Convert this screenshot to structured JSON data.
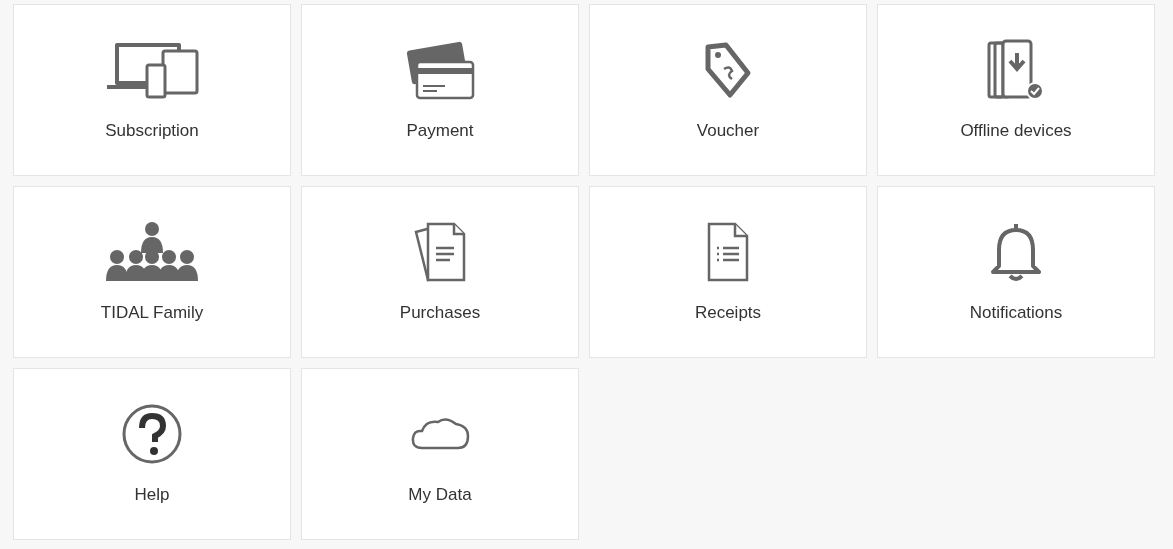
{
  "tiles": [
    {
      "label": "Subscription",
      "kind": "devices"
    },
    {
      "label": "Payment",
      "kind": "cards"
    },
    {
      "label": "Voucher",
      "kind": "tag"
    },
    {
      "label": "Offline devices",
      "kind": "offline"
    },
    {
      "label": "TIDAL Family",
      "kind": "family"
    },
    {
      "label": "Purchases",
      "kind": "documents"
    },
    {
      "label": "Receipts",
      "kind": "receipt"
    },
    {
      "label": "Notifications",
      "kind": "bell"
    },
    {
      "label": "Help",
      "kind": "help"
    },
    {
      "label": "My Data",
      "kind": "cloud"
    }
  ]
}
